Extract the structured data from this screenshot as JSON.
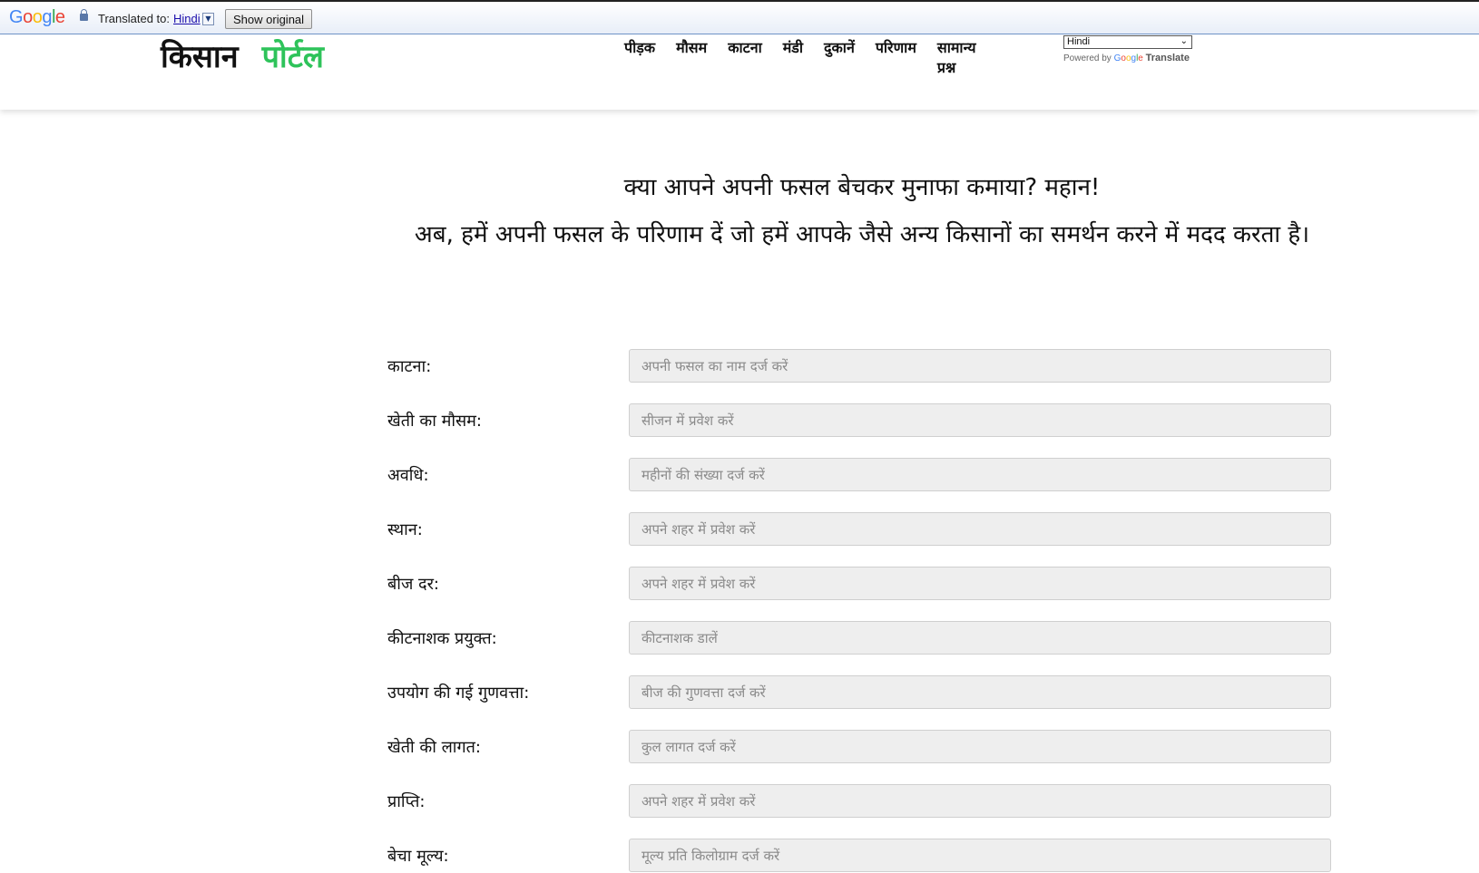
{
  "translate_bar": {
    "logo": "Google",
    "translated_to_label": "Translated to:",
    "language": "Hindi",
    "show_original_label": "Show original"
  },
  "header": {
    "brand_part1": "किसान",
    "brand_part2": "पोर्टल",
    "brand_accent_color": "#2ec35a",
    "nav": [
      {
        "label": "पीड़क"
      },
      {
        "label": "मौसम"
      },
      {
        "label": "काटना"
      },
      {
        "label": "मंडी"
      },
      {
        "label": "दुकानें"
      },
      {
        "label": "परिणाम"
      },
      {
        "label": "सामान्य प्रश्न"
      }
    ],
    "language_select": "Hindi",
    "powered_by": "Powered by",
    "powered_google": "Google",
    "powered_translate": "Translate"
  },
  "main": {
    "headline": "क्या आपने अपनी फसल बेचकर मुनाफा कमाया? महान!",
    "subline": "अब, हमें अपनी फसल के परिणाम दें जो हमें आपके जैसे अन्य किसानों का समर्थन करने में मदद करता है।",
    "fields": [
      {
        "label": "काटना:",
        "placeholder": "अपनी फसल का नाम दर्ज करें"
      },
      {
        "label": "खेती का मौसम:",
        "placeholder": "सीजन में प्रवेश करें"
      },
      {
        "label": "अवधि:",
        "placeholder": "महीनों की संख्या दर्ज करें"
      },
      {
        "label": "स्थान:",
        "placeholder": "अपने शहर में प्रवेश करें"
      },
      {
        "label": "बीज दर:",
        "placeholder": "अपने शहर में प्रवेश करें"
      },
      {
        "label": "कीटनाशक प्रयुक्त:",
        "placeholder": "कीटनाशक डालें"
      },
      {
        "label": "उपयोग की गई गुणवत्ता:",
        "placeholder": "बीज की गुणवत्ता दर्ज करें"
      },
      {
        "label": "खेती की लागत:",
        "placeholder": "कुल लागत दर्ज करें"
      },
      {
        "label": "प्राप्ति:",
        "placeholder": "अपने शहर में प्रवेश करें"
      },
      {
        "label": "बेचा मूल्य:",
        "placeholder": "मूल्य प्रति किलोग्राम दर्ज करें"
      }
    ]
  }
}
